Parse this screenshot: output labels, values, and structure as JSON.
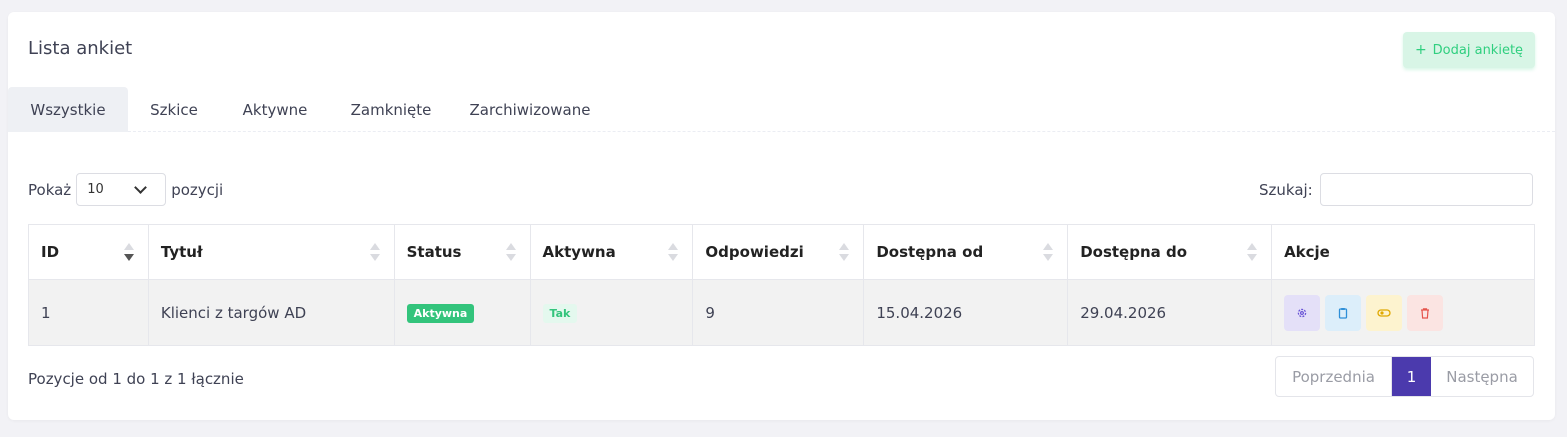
{
  "header": {
    "title": "Lista ankiet",
    "add_button": "Dodaj ankietę",
    "add_icon": "+"
  },
  "tabs": [
    {
      "label": "Wszystkie",
      "active": true
    },
    {
      "label": "Szkice",
      "active": false
    },
    {
      "label": "Aktywne",
      "active": false
    },
    {
      "label": "Zamknięte",
      "active": false
    },
    {
      "label": "Zarchiwizowane",
      "active": false
    }
  ],
  "length": {
    "prefix": "Pokaż",
    "value": "10",
    "suffix": "pozycji"
  },
  "search": {
    "label": "Szukaj:",
    "value": ""
  },
  "table": {
    "headers": [
      "ID",
      "Tytuł",
      "Status",
      "Aktywna",
      "Odpowiedzi",
      "Dostępna od",
      "Dostępna do",
      "Akcje"
    ],
    "rows": [
      {
        "id": "1",
        "title": "Klienci z targów AD",
        "status": "Aktywna",
        "active": "Tak",
        "responses": "9",
        "from": "15.04.2026",
        "to": "29.04.2026"
      }
    ]
  },
  "info": "Pozycje od 1 do 1 z 1 łącznie",
  "pagination": {
    "prev": "Poprzednia",
    "current": "1",
    "next": "Następna"
  },
  "colors": {
    "accent": "#4b3aad",
    "success": "#33c47c",
    "add_bg": "#d8f5e6"
  }
}
